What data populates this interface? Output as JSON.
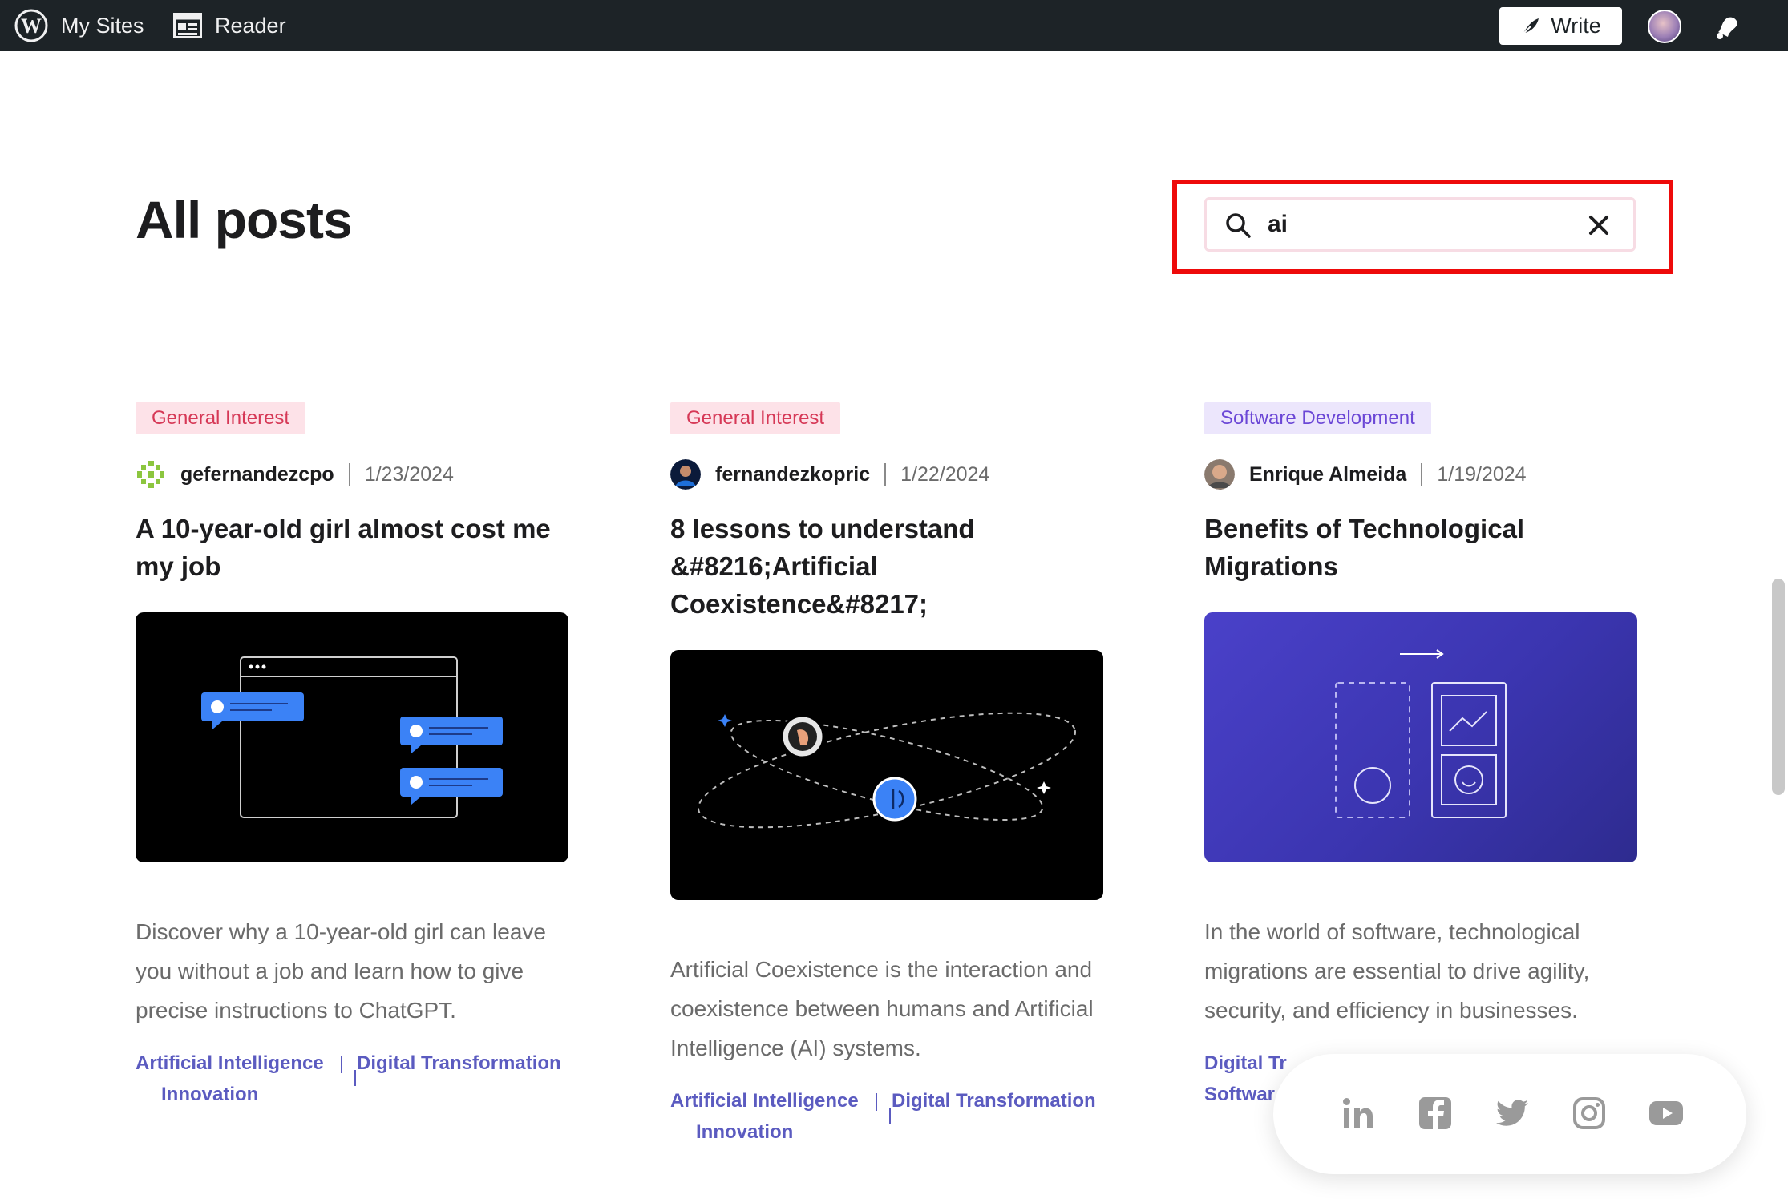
{
  "topbar": {
    "my_sites": "My Sites",
    "reader": "Reader",
    "write": "Write"
  },
  "page": {
    "title": "All posts"
  },
  "search": {
    "value": "ai"
  },
  "posts": [
    {
      "category": "General Interest",
      "author": "gefernandezcpo",
      "date": "1/23/2024",
      "title": "A 10-year-old girl almost cost me my job",
      "excerpt": "Discover why a 10-year-old girl can leave you without a job and learn how to give precise instructions to ChatGPT.",
      "tags": [
        "Artificial Intelligence",
        "Digital Transformation",
        "Innovation"
      ]
    },
    {
      "category": "General Interest",
      "author": "fernandezkopric",
      "date": "1/22/2024",
      "title": "8 lessons to understand &#8216;Artificial Coexistence&#8217;",
      "excerpt": "Artificial Coexistence is the interaction and coexistence between humans and Artificial Intelligence (AI) systems.",
      "tags": [
        "Artificial Intelligence",
        "Digital Transformation",
        "Innovation"
      ]
    },
    {
      "category": "Software Development",
      "author": "Enrique Almeida",
      "date": "1/19/2024",
      "title": "Benefits of Technological Migrations",
      "excerpt": "In the world of software, technological migrations are essential to drive agility, security, and efficiency in businesses.",
      "tags": [
        "Digital Tr",
        "Softwar"
      ]
    }
  ],
  "social": [
    "linkedin-icon",
    "facebook-icon",
    "twitter-icon",
    "instagram-icon",
    "youtube-icon"
  ],
  "colors": {
    "topbar": "#1d2327",
    "highlight": "#ee0a0a",
    "tag_link": "#5b5bc0",
    "badge_pink_text": "#d63856",
    "badge_purple_text": "#6b47d6"
  }
}
